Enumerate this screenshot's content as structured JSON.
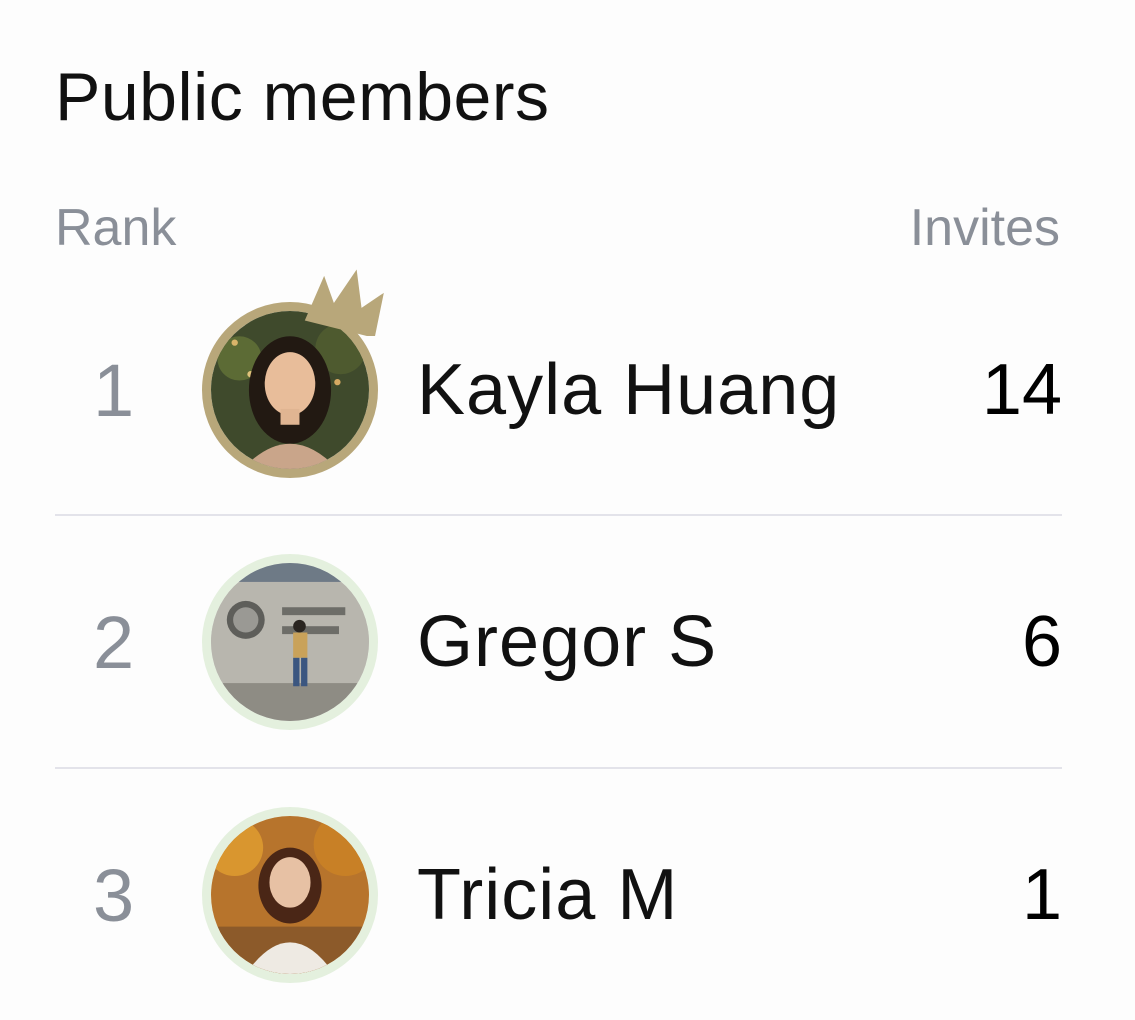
{
  "header": {
    "title": "Public members"
  },
  "columns": {
    "rank": "Rank",
    "invites": "Invites"
  },
  "members": [
    {
      "rank": "1",
      "name": "Kayla Huang",
      "invites": "14",
      "avatar": "avatar-photo",
      "crown": true
    },
    {
      "rank": "2",
      "name": "Gregor S",
      "invites": "6",
      "avatar": "avatar-photo",
      "crown": false
    },
    {
      "rank": "3",
      "name": "Tricia M",
      "invites": "1",
      "avatar": "avatar-photo",
      "crown": false
    }
  ],
  "colors": {
    "gold_ring": "#b8a77a",
    "green_ring": "#e4f0de",
    "muted_text": "#8a8f98",
    "divider": "#e3e3ea"
  }
}
